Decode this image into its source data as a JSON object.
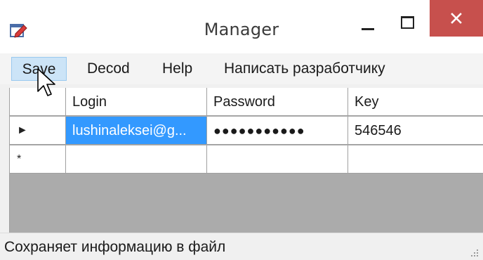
{
  "window": {
    "title": "Manager"
  },
  "icons": {
    "app": "edit-document-icon",
    "minimize": "minimize-icon",
    "maximize": "maximize-icon",
    "close": "close-icon",
    "cursor": "mouse-pointer-icon",
    "row_current": "current-row-arrow-icon",
    "row_new": "new-row-asterisk-icon",
    "grip": "resize-grip-icon"
  },
  "menu": {
    "items": [
      {
        "label": "Save"
      },
      {
        "label": "Decod"
      },
      {
        "label": "Help"
      },
      {
        "label": "Написать разработчику"
      }
    ]
  },
  "grid": {
    "columns": [
      "Login",
      "Password",
      "Key"
    ],
    "rows": [
      {
        "marker": "►",
        "login": "lushinaleksei@g...",
        "password": "●●●●●●●●●●●",
        "key": "546546"
      },
      {
        "marker": "*",
        "login": "",
        "password": "",
        "key": ""
      }
    ]
  },
  "status": {
    "text": "Сохраняет информацию в файл"
  },
  "colors": {
    "close_button": "#c7504d",
    "selection": "#3399ff",
    "menu_hover": "#cce4f7",
    "grid_background": "#ababab"
  }
}
